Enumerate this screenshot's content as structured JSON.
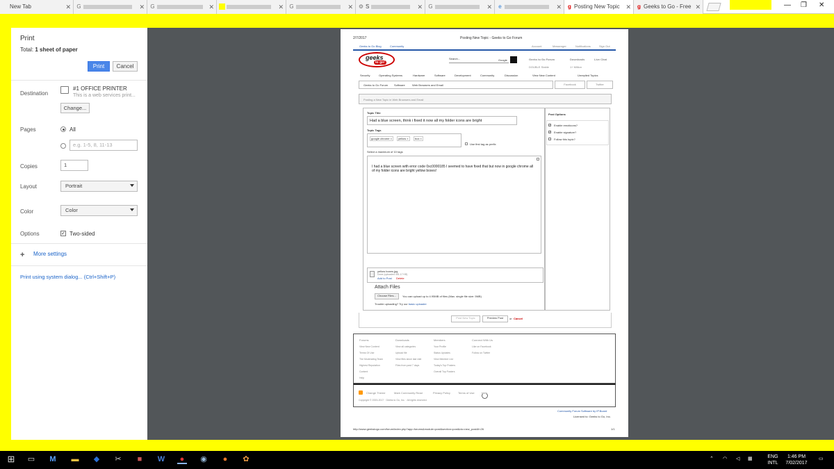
{
  "browser": {
    "tabs": [
      {
        "label": "New Tab",
        "icon": "none"
      },
      {
        "label": "",
        "icon": "google-icon"
      },
      {
        "label": "",
        "icon": "google-icon"
      },
      {
        "label": "",
        "icon": "yellow-icon"
      },
      {
        "label": "",
        "icon": "google-icon"
      },
      {
        "label": "S",
        "icon": "gear-icon"
      },
      {
        "label": "",
        "icon": "google-icon"
      },
      {
        "label": "",
        "icon": "edge-icon"
      },
      {
        "label": "Posting New Topic",
        "icon": "geeks-icon"
      },
      {
        "label": "Geeks to Go - Free",
        "icon": "geeks-icon"
      }
    ]
  },
  "print": {
    "title": "Print",
    "total_label": "Total:",
    "total_value": "1 sheet of paper",
    "print_button": "Print",
    "cancel_button": "Cancel",
    "destination_label": "Destination",
    "printer_name": "#1 OFFICE PRINTER",
    "printer_sub": "This is a web services print...",
    "change_button": "Change...",
    "pages_label": "Pages",
    "pages_all": "All",
    "pages_placeholder": "e.g. 1-5, 8, 11-13",
    "copies_label": "Copies",
    "copies_value": "1",
    "layout_label": "Layout",
    "layout_value": "Portrait",
    "color_label": "Color",
    "color_value": "Color",
    "options_label": "Options",
    "two_sided": "Two-sided",
    "more_settings": "More settings",
    "system_dialog": "Print using system dialog... (Ctrl+Shift+P)"
  },
  "page": {
    "date": "2/7/2017",
    "header_title": "Posting New Topic - Geeks to Go Forum",
    "toplinks": [
      "Geeks to Go Blog",
      "Community"
    ],
    "toprightlinks": [
      "Account",
      "Messenger",
      "Notifications",
      "Sign Out"
    ],
    "logo_line1": "geeks",
    "logo_line2": "to go!",
    "search_label": "Search...",
    "search_engine": "Google",
    "stats": [
      "Geeks to Go Forum",
      "Downloads",
      "Live Chat",
      "DOUBLE Stable",
      "1+ Million"
    ],
    "nav": [
      "Security",
      "Operating Systems",
      "Hardware",
      "Software",
      "Development",
      "Community",
      "Discussion"
    ],
    "nav_right": [
      "View New Content",
      "Unreplied Topics"
    ],
    "breadcrumb": [
      "Geeks to Go Forum",
      "Software",
      "Web Browsers and Email"
    ],
    "social": [
      "Facebook",
      "Twitter"
    ],
    "posting_heading": "Posting a New Topic in Web Browsers and Email",
    "topic_title_label": "Topic Title",
    "topic_title_value": "Had a blue screen, think i fixed it now all my folder icons are bright",
    "topic_tags_label": "Topic Tags",
    "tags": [
      "google chrome ×",
      "yellow ×",
      "box ×"
    ],
    "first_tag_prefix": "Use first tag as prefix",
    "max_tags": "Select a maximum of 10 tags",
    "post_body": "I had a blue screen with error code 0xc0000185 I seemed to have fixed that but now in google chrome all of my folder icons are bright yellow boxes!",
    "post_options_title": "Post Options",
    "post_options": [
      "Enable emoticons?",
      "Enable signature?",
      "Follow this topic?"
    ],
    "attachment_name": "yellow boxes.jpg",
    "attachment_meta": "Done (uploaded 451.17 KB)",
    "attachment_links": [
      "Add to Post",
      "Delete"
    ],
    "attach_files_title": "Attach Files",
    "choose_files": "Choose Files...",
    "upload_info": "You can upload up to 4.95MB of files (Max. single file size: 5MB)",
    "trouble_uploading": "Trouble uploading? Try our",
    "basic_uploader": "basic uploader",
    "btn_post": "Post New Topic",
    "btn_preview": "Preview Post",
    "or_text": "or",
    "cancel_link": "Cancel",
    "footer_cols": [
      {
        "title": "Forums",
        "links": [
          "View New Content",
          "Terms Of Use",
          "The Moderating Team",
          "Highest Reputation",
          "Content",
          "Help"
        ]
      },
      {
        "title": "Downloads",
        "links": [
          "View all categories",
          "Upload file",
          "View files since last visit",
          "Files from past 7 days"
        ]
      },
      {
        "title": "Members",
        "links": [
          "Your Profile",
          "Status Updates",
          "View Member List",
          "Today's Top Posters",
          "Overall Top Posters"
        ]
      },
      {
        "title": "Connect With Us",
        "links": [
          "Like on Facebook",
          "Follow on Twitter"
        ]
      }
    ],
    "footer_links": [
      "Change Theme",
      "Mark Community Read",
      "Privacy Policy",
      "Terms of Use",
      "Help"
    ],
    "copyright": "Copyright © 2003-2017 · Geeks to Go, Inc. · All rights reserved.",
    "ipboard": "Community Forum Software by IP.Board",
    "licensed": "Licensed to: Geeks to Go, Inc.",
    "url": "http://www.geekstogo.com/forum/index.php?app=forums&module=post&section=post&do=new_post&f=26",
    "page_num": "1/1"
  },
  "taskbar": {
    "lang": "ENG",
    "lang_sub": "INTL",
    "time": "1:46 PM",
    "date": "7/02/2017"
  }
}
